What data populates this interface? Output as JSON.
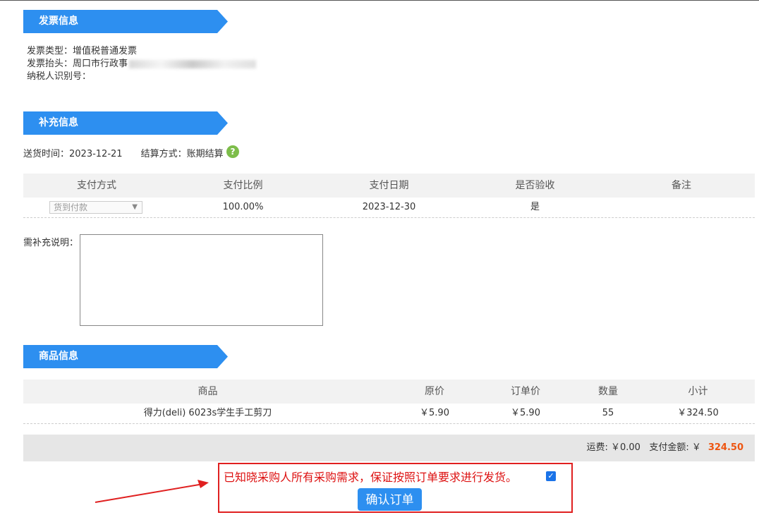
{
  "sections": {
    "invoice_title": "发票信息",
    "supplement_title": "补充信息",
    "goods_title": "商品信息"
  },
  "invoice": {
    "type_label": "发票类型：",
    "type_value": "增值税普通发票",
    "header_label": "发票抬头：",
    "header_value": "周口市行政事",
    "taxid_label": "纳税人识别号："
  },
  "supplement": {
    "delivery_label": "送货时间：",
    "delivery_value": "2023-12-21",
    "settle_label": "结算方式：",
    "settle_value": "账期结算",
    "help_icon": "?"
  },
  "payment_table": {
    "headers": [
      "支付方式",
      "支付比例",
      "支付日期",
      "是否验收",
      "备注"
    ],
    "row": {
      "method": "货到付款",
      "ratio": "100.00%",
      "date": "2023-12-30",
      "accepted": "是",
      "remark": ""
    }
  },
  "remark": {
    "label": "需补充说明：",
    "value": ""
  },
  "goods_table": {
    "headers": [
      "商品",
      "原价",
      "订单价",
      "数量",
      "小计"
    ],
    "rows": [
      {
        "name": "得力(deli) 6023s学生手工剪刀",
        "orig_price": "￥5.90",
        "order_price": "￥5.90",
        "qty": "55",
        "subtotal": "￥324.50"
      }
    ]
  },
  "totals": {
    "shipping_label": "运费: ",
    "shipping_value": "￥0.00",
    "pay_label": "支付金额: ￥",
    "pay_value": "324.50"
  },
  "confirm": {
    "statement": "已知晓采购人所有采购需求，保证按照订单要求进行发货。",
    "checked": true,
    "check_glyph": "✓",
    "button_label": "确认订单"
  },
  "colors": {
    "accent": "#2d8ff0",
    "highlight_red": "#e02020",
    "amount_orange": "#ee5511",
    "help_green": "#7dbd4a"
  }
}
